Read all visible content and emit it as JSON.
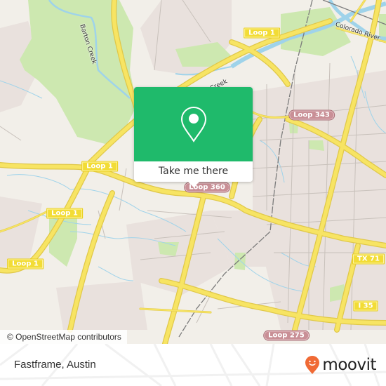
{
  "map": {
    "city": "Austin",
    "colors": {
      "land": "#f2efe9",
      "park": "#cde8b0",
      "urban": "#e8e0dc",
      "water": "#9fd3ea",
      "major_road": "#f7e463",
      "major_road_casing": "#e0c84a",
      "minor_road": "#b5aea8",
      "railway": "#777777"
    },
    "shields": [
      {
        "label": "Loop 1",
        "style": "yellow"
      },
      {
        "label": "Loop 1",
        "style": "yellow"
      },
      {
        "label": "Loop 1",
        "style": "yellow"
      },
      {
        "label": "Loop 1",
        "style": "yellow"
      },
      {
        "label": "Loop 343",
        "style": "maroon"
      },
      {
        "label": "Loop 360",
        "style": "maroon"
      },
      {
        "label": "TX 71",
        "style": "yellow"
      },
      {
        "label": "I 35",
        "style": "yellow"
      },
      {
        "label": "Loop 275",
        "style": "maroon"
      }
    ],
    "labels": {
      "barton_creek": "Barton Creek",
      "creek": "Creek",
      "colorado_river": "Colorado River"
    },
    "attribution": "© OpenStreetMap contributors"
  },
  "popup": {
    "icon": "map-pin-icon",
    "button_label": "Take me there",
    "color": "#1fba6b"
  },
  "footer": {
    "place_name": "Fastframe, Austin",
    "brand": "moovit",
    "brand_color": "#f06a35"
  }
}
